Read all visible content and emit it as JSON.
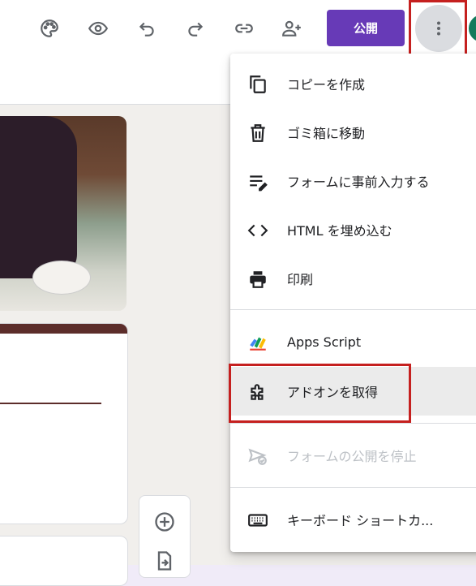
{
  "toolbar": {
    "publish_label": "公開",
    "icons": [
      "palette-icon",
      "eye-icon",
      "undo-icon",
      "redo-icon",
      "link-icon",
      "add-person-icon",
      "more-vert-icon"
    ]
  },
  "menu": {
    "items": [
      {
        "label": "コピーを作成",
        "icon": "copy-icon"
      },
      {
        "label": "ゴミ箱に移動",
        "icon": "trash-icon"
      },
      {
        "label": "フォームに事前入力する",
        "icon": "prefill-icon"
      },
      {
        "label": "HTML を埋め込む",
        "icon": "code-icon"
      },
      {
        "label": "印刷",
        "icon": "print-icon"
      },
      {
        "label": "Apps Script",
        "icon": "apps-script-icon"
      },
      {
        "label": "アドオンを取得",
        "icon": "puzzle-icon"
      },
      {
        "label": "フォームの公開を停止",
        "icon": "unpublish-icon",
        "disabled": true
      },
      {
        "label": "キーボード ショートカ...",
        "icon": "keyboard-icon"
      }
    ]
  },
  "colors": {
    "accent": "#673ab7",
    "highlight": "#c5201f",
    "theme": "#5c2d2a"
  }
}
